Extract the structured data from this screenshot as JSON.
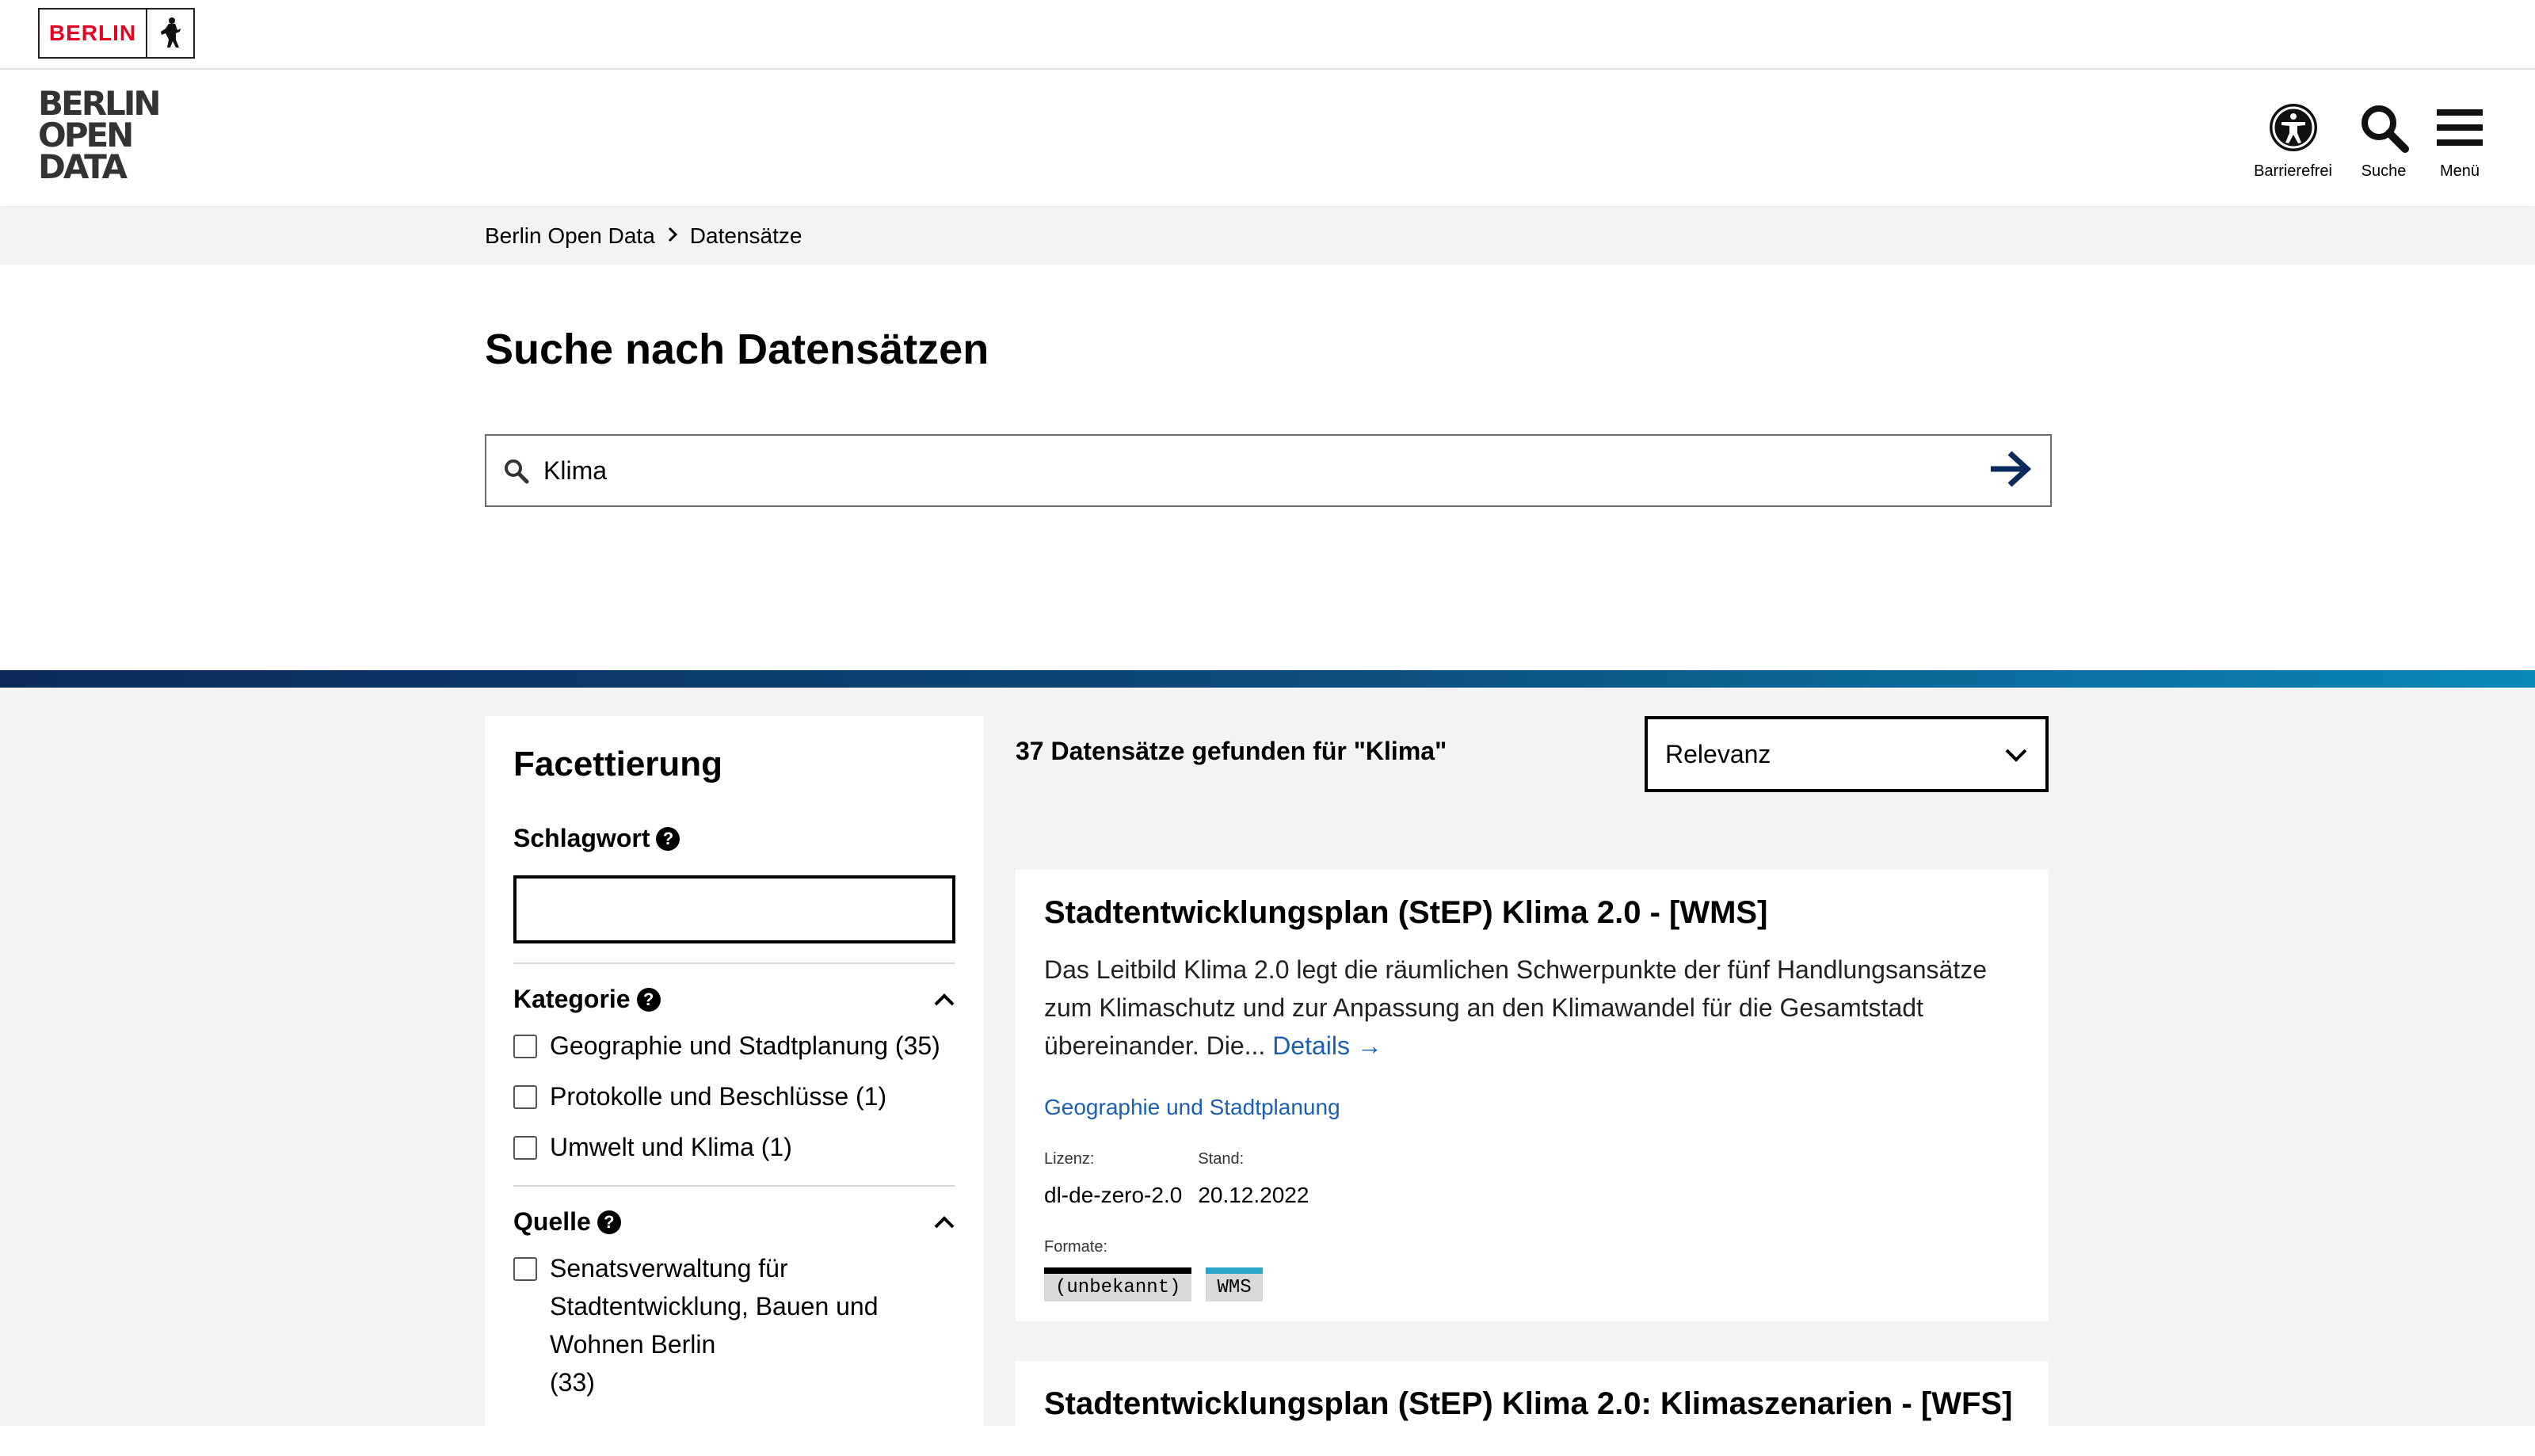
{
  "top_logo": {
    "text": "BERLIN"
  },
  "site_logo": {
    "lines": [
      "BERLIN",
      "OPEN",
      "DATA"
    ]
  },
  "header": {
    "accessibility_label": "Barrierefrei",
    "search_label": "Suche",
    "menu_label": "Menü"
  },
  "breadcrumb": [
    "Berlin Open Data",
    "Datensätze"
  ],
  "search": {
    "title": "Suche nach Datensätzen",
    "value": "Klima"
  },
  "facets": {
    "title": "Facettierung",
    "keyword": {
      "label": "Schlagwort",
      "value": ""
    },
    "category": {
      "label": "Kategorie",
      "options": [
        "Geographie und Stadtplanung (35)",
        "Protokolle und Beschlüsse (1)",
        "Umwelt und Klima (1)"
      ]
    },
    "source": {
      "label": "Quelle",
      "options": [
        "Senatsverwaltung für Stadtentwicklung, Bauen und Wohnen Berlin (33)"
      ],
      "option_lines": [
        "Senatsverwaltung für",
        "Stadtentwicklung, Bauen und",
        "Wohnen Berlin",
        "(33)"
      ]
    }
  },
  "results": {
    "count_text": "37 Datensätze gefunden für \"Klima\"",
    "sort_value": "Relevanz",
    "items": [
      {
        "title": "Stadtentwicklungsplan (StEP) Klima 2.0 - [WMS]",
        "description": "Das Leitbild Klima 2.0 legt die räumlichen Schwerpunkte der fünf Handlungsansätze zum Klimaschutz und zur Anpassung an den Klimawandel für die Gesamtstadt übereinander. Die...",
        "details_label": "Details",
        "category": "Geographie und Stadtplanung",
        "license_label": "Lizenz:",
        "license": "dl-de-zero-2.0",
        "date_label": "Stand:",
        "date": "20.12.2022",
        "formats_label": "Formate:",
        "formats": [
          "(unbekannt)",
          "WMS"
        ]
      },
      {
        "title": "Stadtentwicklungsplan (StEP) Klima 2.0: Klimaszenarien - [WFS]"
      }
    ]
  }
}
